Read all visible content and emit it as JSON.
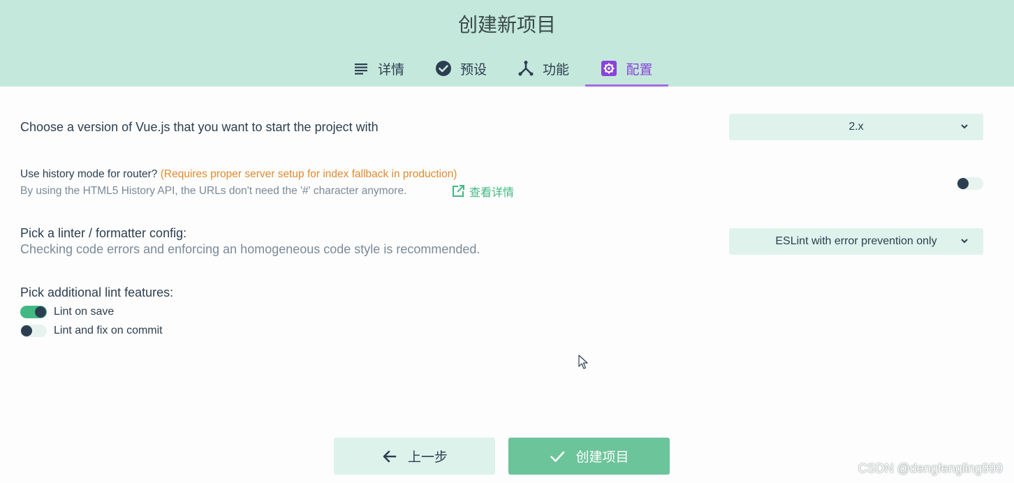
{
  "header": {
    "title": "创建新项目",
    "tabs": [
      {
        "label": "详情",
        "icon": "list-icon"
      },
      {
        "label": "预设",
        "icon": "check-circle-icon"
      },
      {
        "label": "功能",
        "icon": "fork-icon"
      },
      {
        "label": "配置",
        "icon": "settings-icon",
        "active": true
      }
    ]
  },
  "config": {
    "vue_version": {
      "label": "Choose a version of Vue.js that you want to start the project with",
      "value": "2.x"
    },
    "history_mode": {
      "label": "Use history mode for router?",
      "warning": "(Requires proper server setup for index fallback in production)",
      "description": "By using the HTML5 History API, the URLs don't need the '#' character anymore.",
      "link_label": "查看详情",
      "enabled": false
    },
    "linter": {
      "label": "Pick a linter / formatter config:",
      "description": "Checking code errors and enforcing an homogeneous code style is recommended.",
      "value": "ESLint with error prevention only"
    },
    "lint_features": {
      "label": "Pick additional lint features:",
      "options": [
        {
          "label": "Lint on save",
          "enabled": true
        },
        {
          "label": "Lint and fix on commit",
          "enabled": false
        }
      ]
    }
  },
  "footer": {
    "prev_label": "上一步",
    "create_label": "创建项目"
  },
  "watermark": "CSDN @dengfengling999",
  "colors": {
    "header_bg": "#c4e8dc",
    "accent_green": "#42b983",
    "active_tab": "#8a44d8",
    "warning": "#e08a2e"
  }
}
